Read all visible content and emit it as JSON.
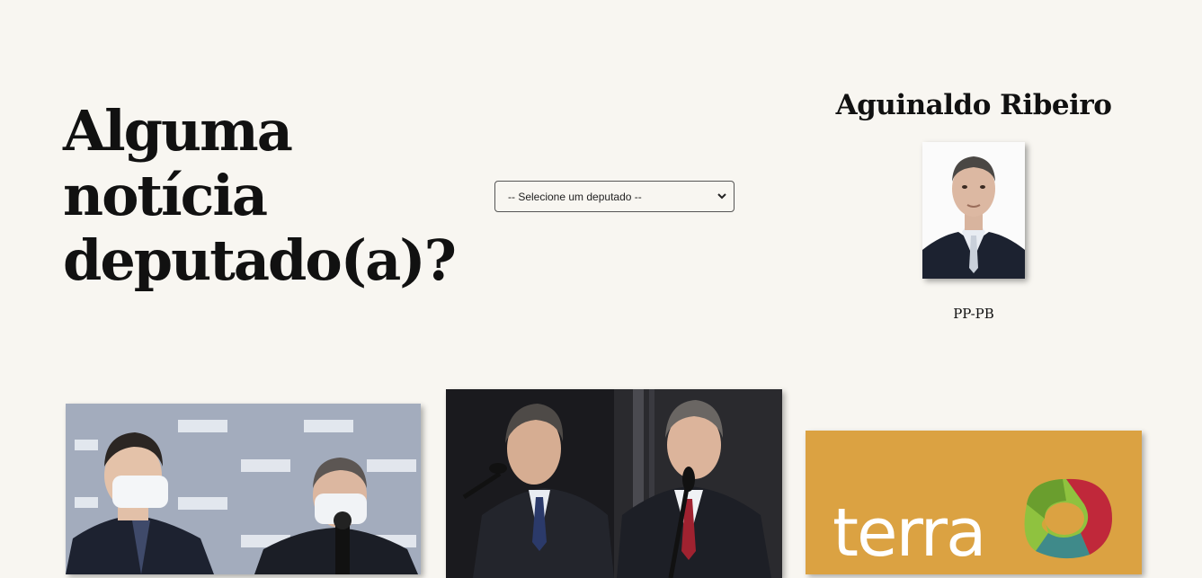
{
  "headline": {
    "line1": "Alguma",
    "line2": "notícia",
    "line3": "deputado(a)?"
  },
  "deputy_select": {
    "selected": "-- Selecione um deputado --"
  },
  "profile": {
    "name": "Aguinaldo Ribeiro",
    "party_state": "PP-PB"
  },
  "news_cards": [
    {
      "image": "politicians-press-conference-photo"
    },
    {
      "image": "deputies-speaking-plenary-photo"
    },
    {
      "image": "terra-logo",
      "logo_text": "terra"
    }
  ],
  "colors": {
    "background": "#f8f6f1",
    "terra_orange": "#dba242"
  }
}
